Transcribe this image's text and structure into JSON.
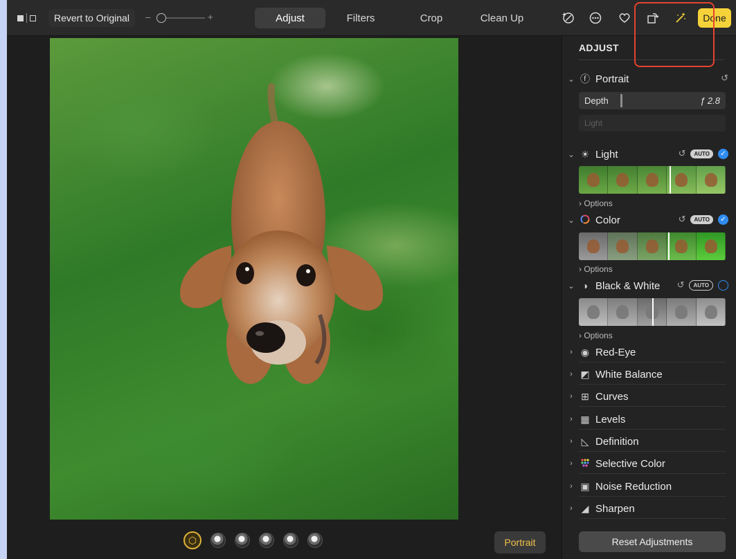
{
  "toolbar": {
    "view_toggle_icon": "split-view-icon",
    "revert_label": "Revert to Original",
    "zoom_minus": "–",
    "zoom_plus": "+",
    "tabs": [
      {
        "label": "Adjust",
        "active": true
      },
      {
        "label": "Filters",
        "active": false
      },
      {
        "label": "Crop",
        "active": false
      },
      {
        "label": "Clean Up",
        "active": false
      }
    ],
    "icons": [
      "retouch-icon",
      "more-icon",
      "heart-icon",
      "rotate-icon",
      "magic-wand-icon"
    ],
    "done_label": "Done",
    "accent_color": "#f6d23a",
    "highlight_color": "#e5432f"
  },
  "filmstrip": {
    "items": [
      "portrait-lighting-icon",
      "lighting-dot",
      "lighting-dot",
      "lighting-dot",
      "lighting-dot",
      "lighting-dot"
    ],
    "portrait_label": "Portrait"
  },
  "sidebar": {
    "title": "ADJUST",
    "portrait": {
      "label": "Portrait",
      "depth_label": "Depth",
      "depth_value": "ƒ 2.8",
      "light_label": "Light"
    },
    "light": {
      "label": "Light",
      "auto": "AUTO",
      "checked": true,
      "options_label": "Options"
    },
    "color": {
      "label": "Color",
      "auto": "AUTO",
      "checked": true,
      "options_label": "Options"
    },
    "bw": {
      "label": "Black & White",
      "auto": "AUTO",
      "checked": false,
      "options_label": "Options"
    },
    "collapsed": [
      {
        "label": "Red-Eye",
        "icon": "eye-icon"
      },
      {
        "label": "White Balance",
        "icon": "white-balance-icon"
      },
      {
        "label": "Curves",
        "icon": "curves-icon"
      },
      {
        "label": "Levels",
        "icon": "levels-icon"
      },
      {
        "label": "Definition",
        "icon": "definition-icon"
      },
      {
        "label": "Selective Color",
        "icon": "selective-color-icon"
      },
      {
        "label": "Noise Reduction",
        "icon": "noise-reduction-icon"
      },
      {
        "label": "Sharpen",
        "icon": "sharpen-icon"
      }
    ],
    "reset_label": "Reset Adjustments"
  }
}
